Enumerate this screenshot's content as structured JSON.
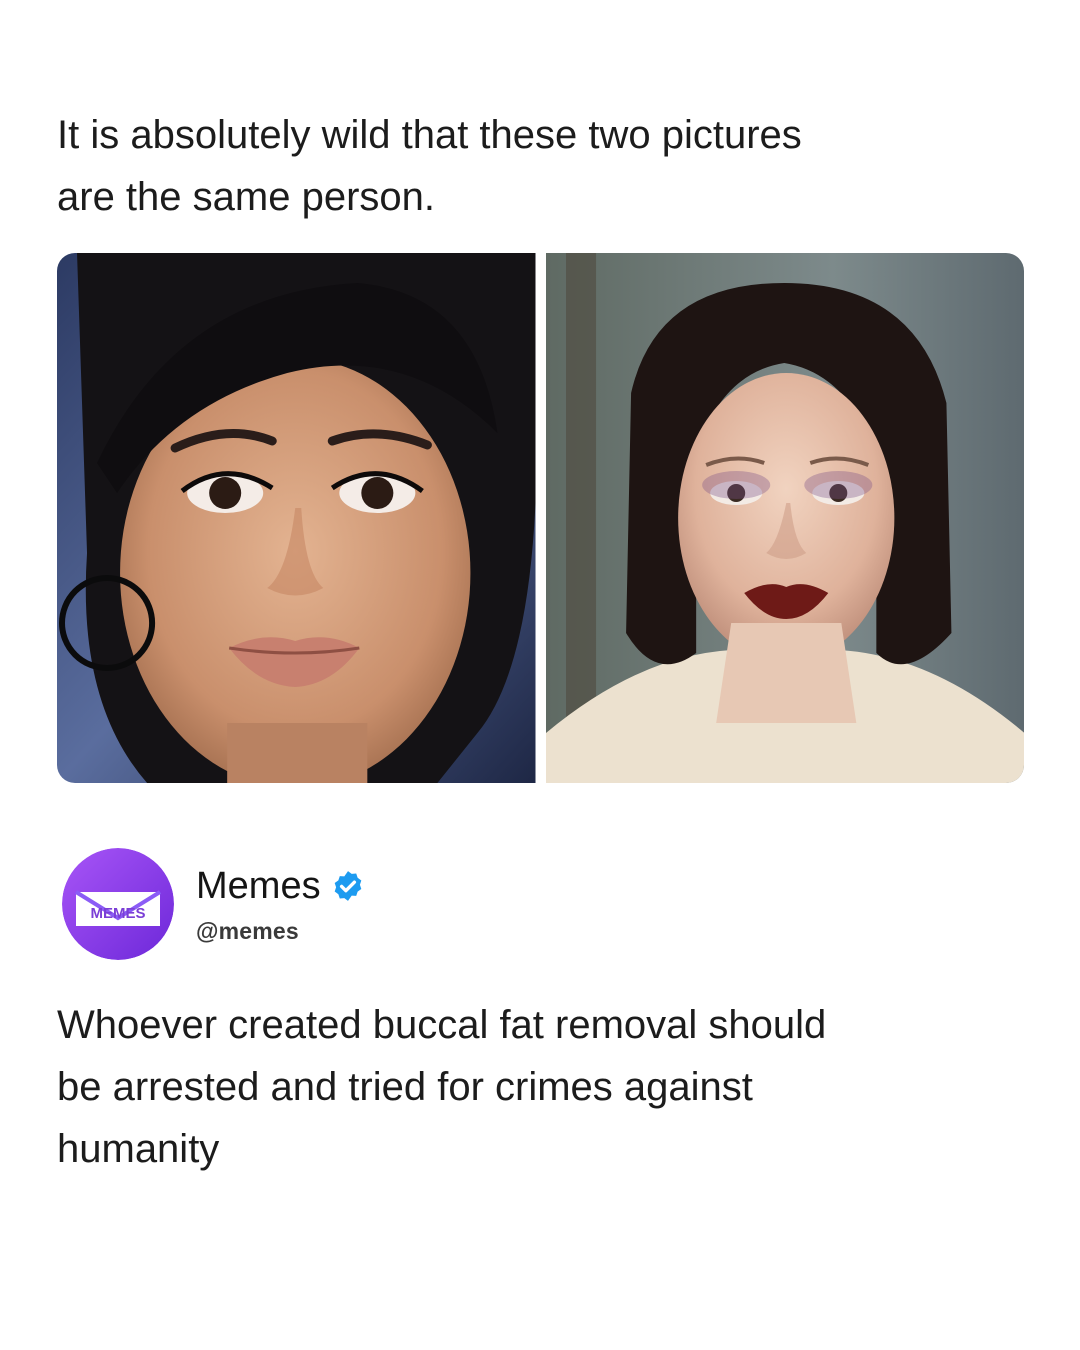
{
  "post": {
    "caption": "It is absolutely wild that these two pictures\nare the same person.",
    "images": [
      {
        "icon": "portrait-photo-left"
      },
      {
        "icon": "portrait-photo-right"
      }
    ]
  },
  "quoted": {
    "author": {
      "display_name": "Memes",
      "handle": "@memes",
      "avatar_text": "MEMES",
      "verified_icon": "verified-badge-icon"
    },
    "text": "Whoever created buccal fat removal should\nbe arrested and tried for crimes against\nhumanity"
  },
  "colors": {
    "verified": "#1d9bf0",
    "avatar_purple": "#8a3ff0",
    "avatar_label": "#7b3fd6"
  }
}
